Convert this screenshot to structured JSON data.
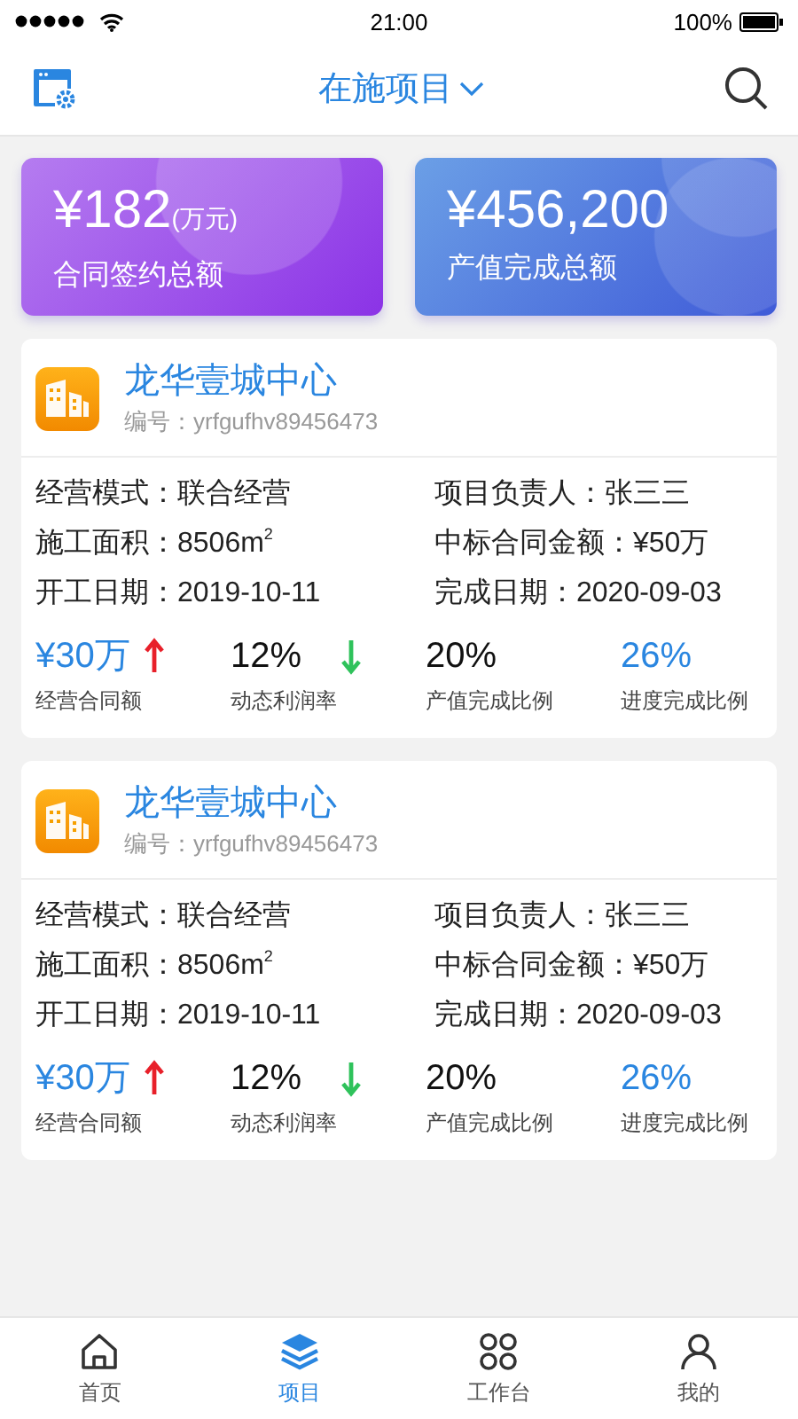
{
  "status_bar": {
    "time": "21:00",
    "battery": "100%"
  },
  "header": {
    "title": "在施项目"
  },
  "summary": [
    {
      "kind": "purple",
      "amount": "¥182",
      "unit": "(万元)",
      "label": "合同签约总额"
    },
    {
      "kind": "blue",
      "amount": "¥456,200",
      "label": "产值完成总额"
    }
  ],
  "projects": [
    {
      "name": "龙华壹城中心",
      "code": "编号：yrfgufhv89456473",
      "fields": [
        {
          "label": "经营模式：",
          "value": "联合经营"
        },
        {
          "label": "项目负责人：",
          "value": "张三三"
        },
        {
          "label": "施工面积：",
          "value": "8506m$^{2}$"
        },
        {
          "label": "中标合同金额：",
          "value": "¥50万"
        },
        {
          "label": "开工日期：",
          "value": "2019-10-11"
        },
        {
          "label": "完成日期：",
          "value": "2020-09-03"
        }
      ],
      "metrics": [
        {
          "value": "¥30万",
          "label": "经营合同额",
          "accent": true,
          "kind": "up"
        },
        {
          "value": "12%",
          "label": "动态利润率",
          "accent": false,
          "kind": "down"
        },
        {
          "value": "20%",
          "label": "产值完成比例",
          "accent": false,
          "kind": "plain"
        },
        {
          "value": "26%",
          "label": "进度完成比例",
          "accent": true,
          "kind": "plain"
        }
      ]
    },
    {
      "name": "龙华壹城中心",
      "code": "编号：yrfgufhv89456473",
      "fields": [
        {
          "label": "经营模式：",
          "value": "联合经营"
        },
        {
          "label": "项目负责人：",
          "value": "张三三"
        },
        {
          "label": "施工面积：",
          "value": "8506m$^{2}$"
        },
        {
          "label": "中标合同金额：",
          "value": "¥50万"
        },
        {
          "label": "开工日期：",
          "value": "2019-10-11"
        },
        {
          "label": "完成日期：",
          "value": "2020-09-03"
        }
      ],
      "metrics": [
        {
          "value": "¥30万",
          "label": "经营合同额",
          "accent": true,
          "kind": "up"
        },
        {
          "value": "12%",
          "label": "动态利润率",
          "accent": false,
          "kind": "down"
        },
        {
          "value": "20%",
          "label": "产值完成比例",
          "accent": false,
          "kind": "plain"
        },
        {
          "value": "26%",
          "label": "进度完成比例",
          "accent": true,
          "kind": "plain"
        }
      ]
    }
  ],
  "tab_bar": [
    {
      "label": "首页",
      "kind": "home",
      "selected": false
    },
    {
      "label": "项目",
      "kind": "layers",
      "selected": true
    },
    {
      "label": "工作台",
      "kind": "dots",
      "selected": false
    },
    {
      "label": "我的",
      "kind": "person",
      "selected": false
    }
  ]
}
